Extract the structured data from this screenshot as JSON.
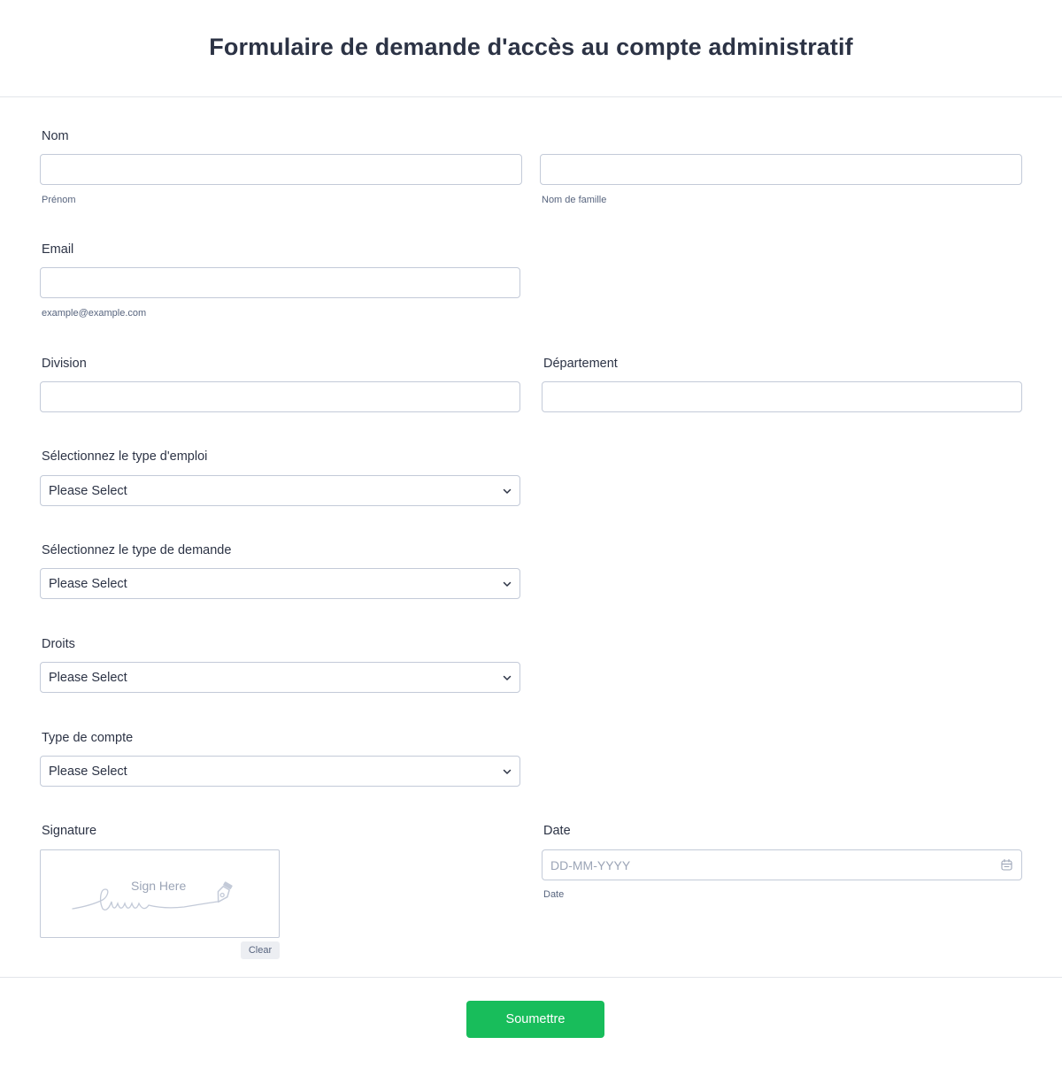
{
  "form": {
    "title": "Formulaire de demande d'accès au compte administratif"
  },
  "fields": {
    "name": {
      "label": "Nom",
      "first_sublabel": "Prénom",
      "last_sublabel": "Nom de famille",
      "first_value": "",
      "last_value": ""
    },
    "email": {
      "label": "Email",
      "sublabel": "example@example.com",
      "value": ""
    },
    "division": {
      "label": "Division",
      "value": ""
    },
    "department": {
      "label": "Département",
      "value": ""
    },
    "employment_type": {
      "label": "Sélectionnez le type d'emploi",
      "selected": "Please Select"
    },
    "request_type": {
      "label": "Sélectionnez le type de demande",
      "selected": "Please Select"
    },
    "rights": {
      "label": "Droits",
      "selected": "Please Select"
    },
    "account_type": {
      "label": "Type de compte",
      "selected": "Please Select"
    },
    "signature": {
      "label": "Signature",
      "placeholder": "Sign Here",
      "clear_label": "Clear"
    },
    "date": {
      "label": "Date",
      "placeholder": "DD-MM-YYYY",
      "sublabel": "Date"
    }
  },
  "actions": {
    "submit_label": "Soumettre"
  },
  "colors": {
    "submit": "#18bd5b",
    "text": "#2c3345",
    "border": "#c3cad8",
    "placeholder": "#9ba4b6"
  },
  "icons": {
    "select_chevron": "chevron-down-icon",
    "calendar": "calendar-icon",
    "signature_pen": "pen-nib-icon"
  }
}
